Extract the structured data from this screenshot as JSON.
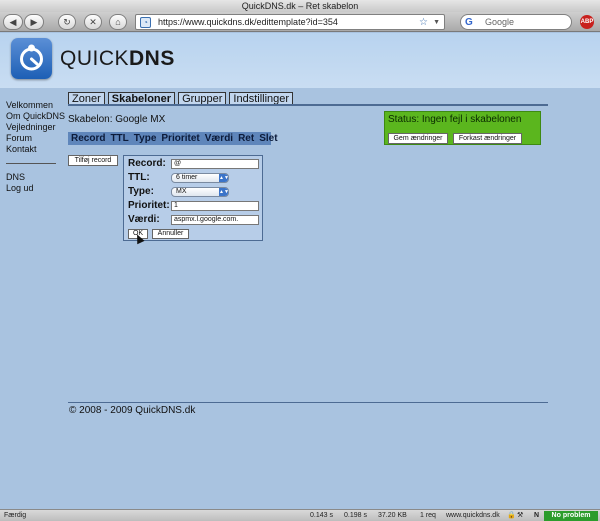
{
  "browser": {
    "window_title": "QuickDNS.dk – Ret skabelon",
    "url": "https://www.quickdns.dk/edittemplate?id=354",
    "search_placeholder": "Google",
    "search_engine_logo": "G",
    "abp_label": "ABP"
  },
  "site": {
    "logo_light": "QUICK",
    "logo_bold": "DNS",
    "brand_color": "#1d5fb5"
  },
  "sidebar": {
    "items": [
      "Velkommen",
      "Om QuickDNS",
      "Vejledninger",
      "Forum",
      "Kontakt"
    ],
    "items2": [
      "DNS",
      "Log ud"
    ]
  },
  "tabs": [
    {
      "label": "Zoner",
      "active": false
    },
    {
      "label": "Skabeloner",
      "active": true
    },
    {
      "label": "Grupper",
      "active": false
    },
    {
      "label": "Indstillinger",
      "active": false
    }
  ],
  "template": {
    "label": "Skabelon: Google MX"
  },
  "status": {
    "text": "Status: Ingen fejl i skabelonen",
    "save_label": "Gem ændringer",
    "discard_label": "Forkast ændringer",
    "color": "#5bb61e"
  },
  "table": {
    "headers": [
      "Record",
      "TTL",
      "Type",
      "Prioritet",
      "Værdi",
      "Ret",
      "Slet"
    ]
  },
  "add_record_label": "Tilføj record",
  "form": {
    "record_label": "Record:",
    "record_value": "@",
    "ttl_label": "TTL:",
    "ttl_value": "6 timer",
    "type_label": "Type:",
    "type_value": "MX",
    "priority_label": "Prioritet:",
    "priority_value": "1",
    "value_label": "Værdi:",
    "value_value": "aspmx.l.google.com.",
    "ok_label": "OK",
    "cancel_label": "Annuller"
  },
  "footer": {
    "copyright": "© 2008 - 2009 QuickDNS.dk"
  },
  "statusbar": {
    "left": "Færdig",
    "time1": "0.143 s",
    "time2": "0.198 s",
    "size": "37.20 KB",
    "requests": "1 req",
    "host": "www.quickdns.dk",
    "badge": "No problem"
  }
}
